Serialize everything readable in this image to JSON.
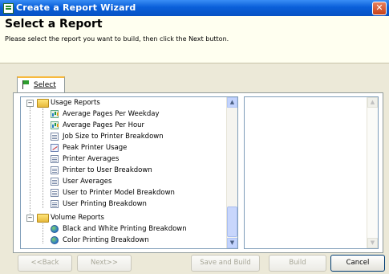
{
  "window": {
    "title": "Create a Report Wizard",
    "close_glyph": "✕"
  },
  "header": {
    "heading": "Select a Report",
    "instructions": "Please select the report you want to build, then click the Next button."
  },
  "tab": {
    "label": "Select",
    "icon": "flag-icon"
  },
  "tree": {
    "groups": [
      {
        "label": "Usage Reports",
        "expander": "−",
        "items": [
          {
            "label": "Average Pages Per Weekday",
            "icon": "bar-chart-icon"
          },
          {
            "label": "Average Pages Per Hour",
            "icon": "bar-chart-icon"
          },
          {
            "label": "Job Size to Printer Breakdown",
            "icon": "table-icon"
          },
          {
            "label": "Peak Printer Usage",
            "icon": "line-chart-icon"
          },
          {
            "label": "Printer Averages",
            "icon": "table-icon"
          },
          {
            "label": "Printer to User Breakdown",
            "icon": "table-icon"
          },
          {
            "label": "User Averages",
            "icon": "table-icon"
          },
          {
            "label": "User to Printer Model Breakdown",
            "icon": "table-icon"
          },
          {
            "label": "User Printing Breakdown",
            "icon": "table-icon"
          }
        ]
      },
      {
        "label": "Volume Reports",
        "expander": "−",
        "items": [
          {
            "label": "Black and White Printing Breakdown",
            "icon": "pie-chart-icon"
          },
          {
            "label": "Color Printing Breakdown",
            "icon": "pie-chart-icon"
          }
        ]
      }
    ]
  },
  "scroll": {
    "up_glyph": "▲",
    "down_glyph": "▼"
  },
  "buttons": {
    "back": "<<Back",
    "next": "Next>>",
    "save_and_build": "Save and Build",
    "build": "Build",
    "cancel": "Cancel"
  },
  "colors": {
    "title_bar": "#0a5fd9",
    "header_band": "#fffff0",
    "dialog_bg": "#ece9d8"
  }
}
